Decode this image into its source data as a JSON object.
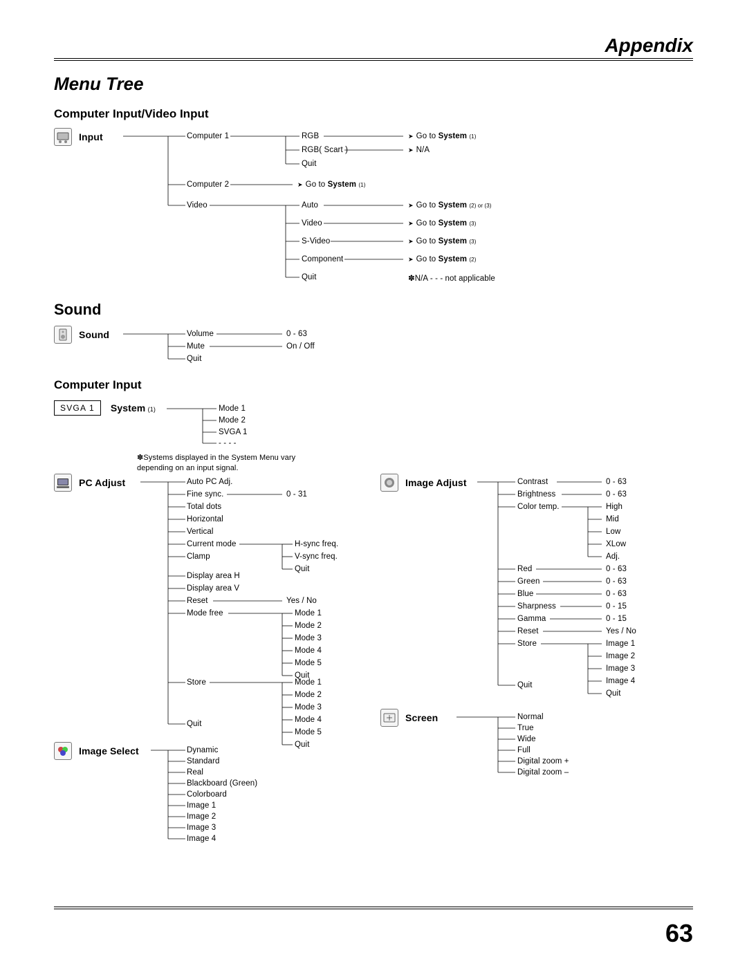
{
  "header": "Appendix",
  "title": "Menu Tree",
  "page_number": "63",
  "sections": {
    "input_video": {
      "heading": "Computer Input/Video Input",
      "root": "Input",
      "computer1": "Computer 1",
      "computer2": "Computer 2",
      "video": "Video",
      "rgb": "RGB",
      "rgb_scart": "RGB( Scart )",
      "quit": "Quit",
      "auto": "Auto",
      "v_video": "Video",
      "svideo": "S-Video",
      "component": "Component",
      "goto_s1": "Go to System (1)",
      "goto_s2": "Go to System (2)",
      "goto_s3": "Go to System (3)",
      "goto_s23": "Go to System (2) or (3)",
      "na": "N/A",
      "na_note": "✽N/A - - - not applicable"
    },
    "sound": {
      "heading": "Sound",
      "root": "Sound",
      "volume": "Volume",
      "mute": "Mute",
      "quit": "Quit",
      "r_vol": "0 - 63",
      "r_mute": "On / Off"
    },
    "computer_input": {
      "heading": "Computer Input",
      "svga": "SVGA 1",
      "system": "System",
      "system_sub": "(1)",
      "mode1": "Mode 1",
      "mode2": "Mode 2",
      "svga1": "SVGA 1",
      "dashes": "- - - -",
      "sys_note": "✽Systems displayed in the System Menu vary depending on an input signal."
    },
    "pc_adjust": {
      "root": "PC Adjust",
      "auto_pc": "Auto PC Adj.",
      "fine": "Fine sync.",
      "total": "Total dots",
      "horiz": "Horizontal",
      "vert": "Vertical",
      "curmode": "Current mode",
      "clamp": "Clamp",
      "disp_h": "Display area H",
      "disp_v": "Display area V",
      "reset": "Reset",
      "modefree": "Mode free",
      "store": "Store",
      "quit": "Quit",
      "r_fine": "0 - 31",
      "hsync": "H-sync freq.",
      "vsync": "V-sync freq.",
      "yesno": "Yes / No",
      "m1": "Mode 1",
      "m2": "Mode 2",
      "m3": "Mode 3",
      "m4": "Mode 4",
      "m5": "Mode 5"
    },
    "image_select": {
      "root": "Image Select",
      "dynamic": "Dynamic",
      "standard": "Standard",
      "real": "Real",
      "bbg": "Blackboard (Green)",
      "colorboard": "Colorboard",
      "img1": "Image 1",
      "img2": "Image 2",
      "img3": "Image 3",
      "img4": "Image 4"
    },
    "image_adjust": {
      "root": "Image Adjust",
      "contrast": "Contrast",
      "brightness": "Brightness",
      "colortemp": "Color temp.",
      "high": "High",
      "mid": "Mid",
      "low": "Low",
      "xlow": "XLow",
      "adj": "Adj.",
      "red": "Red",
      "green": "Green",
      "blue": "Blue",
      "sharp": "Sharpness",
      "gamma": "Gamma",
      "reset": "Reset",
      "store": "Store",
      "quit": "Quit",
      "r063": "0 - 63",
      "r015": "0 - 15",
      "yesno": "Yes / No",
      "img1": "Image 1",
      "img2": "Image 2",
      "img3": "Image 3",
      "img4": "Image 4"
    },
    "screen": {
      "root": "Screen",
      "normal": "Normal",
      "true": "True",
      "wide": "Wide",
      "full": "Full",
      "dzp": "Digital zoom +",
      "dzm": "Digital zoom –"
    }
  }
}
